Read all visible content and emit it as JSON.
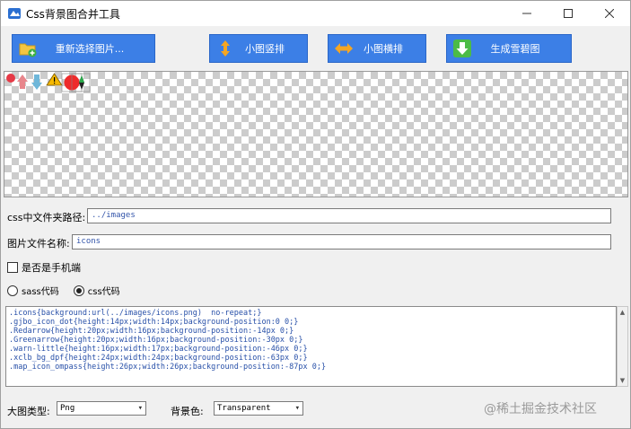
{
  "window": {
    "title": "Css背景图合并工具"
  },
  "toolbar": {
    "reselect_label": "重新选择图片...",
    "vertical_label": "小图竖排",
    "horizontal_label": "小图横排",
    "generate_label": "生成雪碧图"
  },
  "form": {
    "css_path_label": "css中文件夹路径:",
    "css_path_value": "../images",
    "image_name_label": "图片文件名称:",
    "image_name_value": "icons",
    "mobile_label": "是否是手机端",
    "sass_label": "sass代码",
    "css_label": "css代码",
    "selected_mode": "css"
  },
  "code_lines": [
    ".icons{background:url(../images/icons.png)  no-repeat;}",
    ".gjbo_icon_dot{height:14px;width:14px;background-position:0 0;}",
    ".Redarrow{height:20px;width:16px;background-position:-14px 0;}",
    ".Greenarrow{height:20px;width:16px;background-position:-30px 0;}",
    ".warn-little{height:16px;width:17px;background-position:-46px 0;}",
    ".xclb_bg_dpf{height:24px;width:24px;background-position:-63px 0;}",
    ".map_icon_ompass{height:26px;width:26px;background-position:-87px 0;}"
  ],
  "bottom": {
    "image_type_label": "大图类型:",
    "image_type_value": "Png",
    "bg_color_label": "背景色:",
    "bg_color_value": "Transparent"
  },
  "watermark": "@稀土掘金技术社区",
  "colors": {
    "button_blue": "#3c7fe6",
    "code_blue": "#2850a8"
  },
  "icons": [
    "app-icon",
    "folder-add-icon",
    "updown-arrow-icon",
    "leftright-arrow-icon",
    "download-arrow-icon"
  ]
}
